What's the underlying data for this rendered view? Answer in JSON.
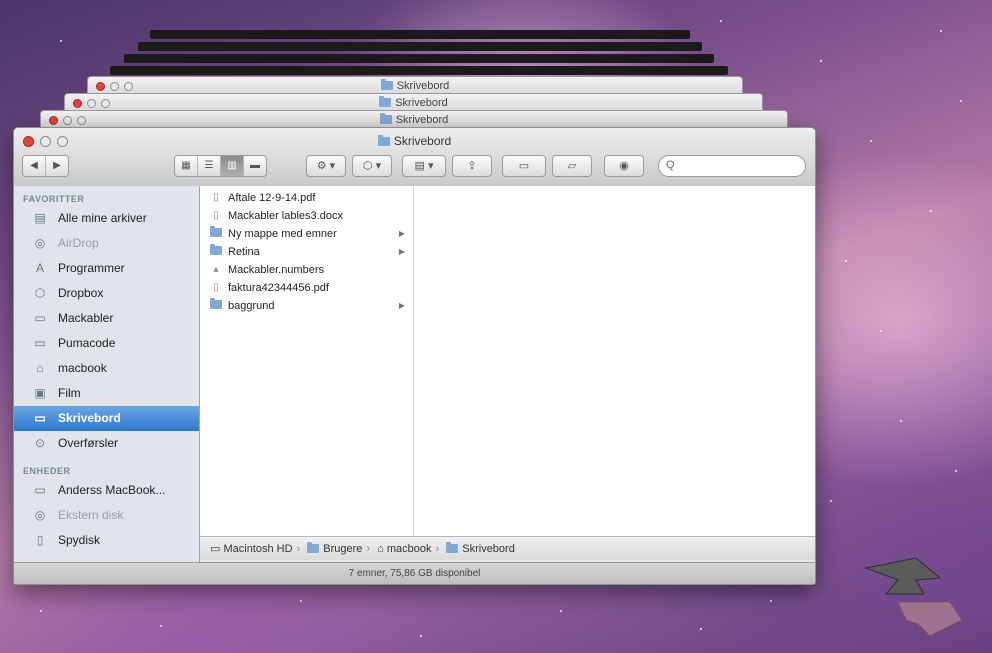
{
  "window": {
    "title": "Skrivebord",
    "back_titles": [
      "Skrivebord",
      "Skrivebord",
      "Skrivebord"
    ]
  },
  "toolbar": {
    "view_buttons": [
      "icon-view",
      "list-view",
      "column-view",
      "coverflow-view"
    ],
    "active_view": "column-view",
    "search_placeholder": "Q"
  },
  "sidebar": {
    "favorites_header": "FAVORITTER",
    "favorites": [
      {
        "label": "Alle mine arkiver",
        "icon": "all-files-icon"
      },
      {
        "label": "AirDrop",
        "icon": "airdrop-icon",
        "dim": true
      },
      {
        "label": "Programmer",
        "icon": "applications-icon"
      },
      {
        "label": "Dropbox",
        "icon": "dropbox-icon"
      },
      {
        "label": "Mackabler",
        "icon": "folder-icon"
      },
      {
        "label": "Pumacode",
        "icon": "folder-icon"
      },
      {
        "label": "macbook",
        "icon": "home-icon"
      },
      {
        "label": "Film",
        "icon": "film-icon"
      },
      {
        "label": "Skrivebord",
        "icon": "desktop-icon",
        "selected": true
      },
      {
        "label": "Overførsler",
        "icon": "downloads-icon"
      }
    ],
    "devices_header": "ENHEDER",
    "devices": [
      {
        "label": "Anderss MacBook...",
        "icon": "computer-icon"
      },
      {
        "label": "Ekstern disk",
        "icon": "disk-icon",
        "dim": true
      },
      {
        "label": "Spydisk",
        "icon": "drive-icon"
      }
    ]
  },
  "files": [
    {
      "name": "Aftale 12-9-14.pdf",
      "kind": "pdf"
    },
    {
      "name": "Mackabler lables3.docx",
      "kind": "doc"
    },
    {
      "name": "Ny mappe med emner",
      "kind": "folder"
    },
    {
      "name": "Retina",
      "kind": "folder"
    },
    {
      "name": "Mackabler.numbers",
      "kind": "numbers"
    },
    {
      "name": "faktura42344456.pdf",
      "kind": "pdf"
    },
    {
      "name": "baggrund",
      "kind": "folder"
    }
  ],
  "pathbar": [
    "Macintosh HD",
    "Brugere",
    "macbook",
    "Skrivebord"
  ],
  "status": "7 emner, 75,86 GB disponibel",
  "colors": {
    "selection": "#3d86d6",
    "sidebar_bg": "#dfe4ea"
  }
}
